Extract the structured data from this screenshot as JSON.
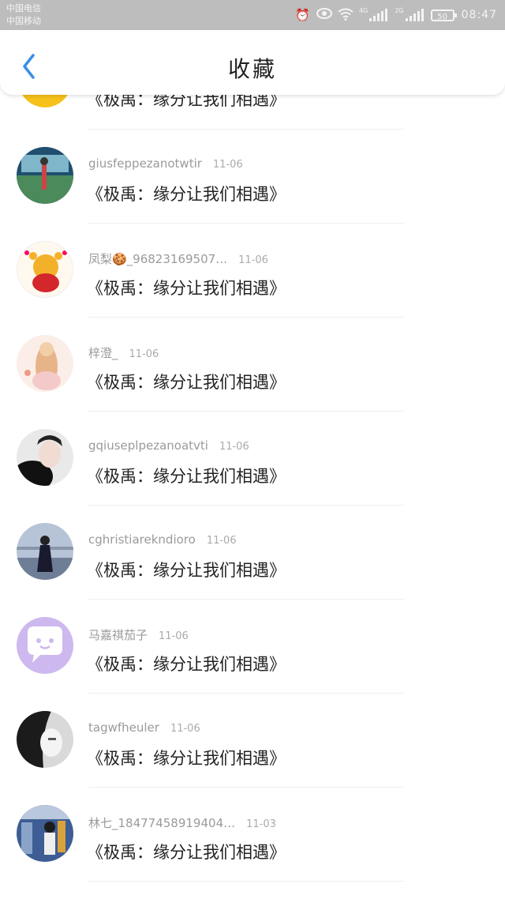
{
  "status": {
    "carrier1": "中国电信",
    "carrier2": "中国移动",
    "net1": "4G",
    "net2": "2G",
    "battery": "50",
    "time": "08:47"
  },
  "header": {
    "title": "收藏"
  },
  "items": [
    {
      "name": "",
      "date": "",
      "text": "《极禹：缘分让我们相遇》"
    },
    {
      "name": "giusfeppezanotwtir",
      "date": "11-06",
      "text": "《极禹：缘分让我们相遇》"
    },
    {
      "name": "凤梨🍪_96823169507…",
      "date": "11-06",
      "text": "《极禹：缘分让我们相遇》"
    },
    {
      "name": "梓澄_",
      "date": "11-06",
      "text": "《极禹：缘分让我们相遇》"
    },
    {
      "name": "gqiuseplpezanoatvti",
      "date": "11-06",
      "text": "《极禹：缘分让我们相遇》"
    },
    {
      "name": "cghristiarekndioro",
      "date": "11-06",
      "text": "《极禹：缘分让我们相遇》"
    },
    {
      "name": "马嘉祺茄子",
      "date": "11-06",
      "text": "《极禹：缘分让我们相遇》"
    },
    {
      "name": "tagwfheuler",
      "date": "11-06",
      "text": "《极禹：缘分让我们相遇》"
    },
    {
      "name": "林七_18477458919404…",
      "date": "11-03",
      "text": "《极禹：缘分让我们相遇》"
    }
  ],
  "colors": {
    "accent": "#3a8ee6",
    "statusbar": "#bdbdbd"
  },
  "icons": [
    "back-arrow-icon",
    "alarm-icon",
    "eye-icon",
    "wifi-icon",
    "signal-icon",
    "battery-icon"
  ]
}
